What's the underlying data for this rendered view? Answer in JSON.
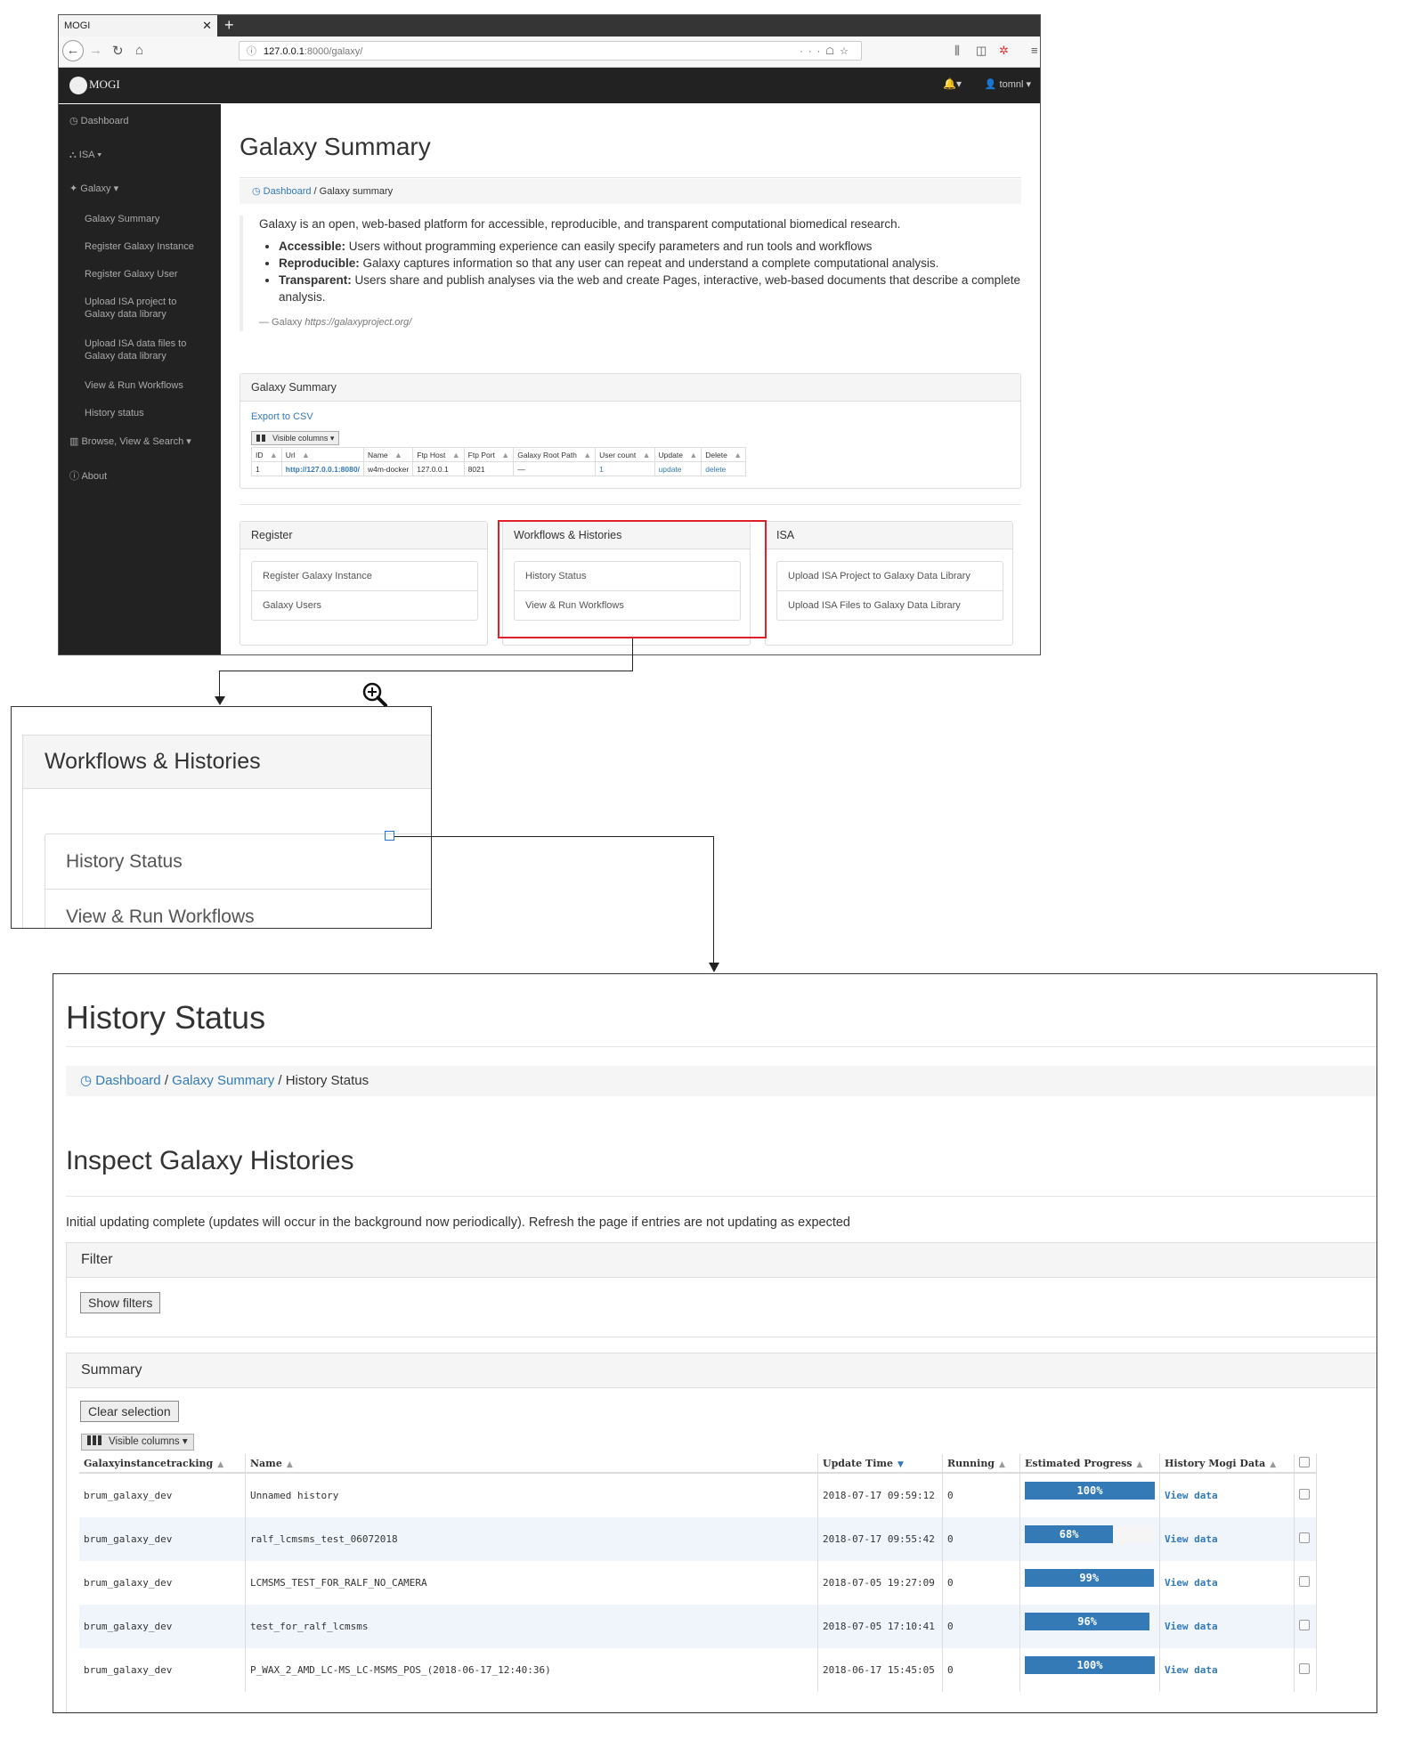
{
  "browser": {
    "tab_title": "MOGI",
    "url_host": "127.0.0.1",
    "url_path": ":8000/galaxy/",
    "app_brand": "MOGI",
    "user": "tomnl"
  },
  "sidebar": {
    "items": [
      {
        "label": "Dashboard"
      },
      {
        "label": "ISA"
      },
      {
        "label": "Galaxy"
      },
      {
        "label": "Galaxy Summary"
      },
      {
        "label": "Register Galaxy Instance"
      },
      {
        "label": "Register Galaxy User"
      },
      {
        "label": "Upload ISA project to Galaxy data library"
      },
      {
        "label": "Upload ISA data files to Galaxy data library"
      },
      {
        "label": "View & Run Workflows"
      },
      {
        "label": "History status"
      },
      {
        "label": "Browse, View & Search"
      },
      {
        "label": "About"
      }
    ]
  },
  "galaxy_page": {
    "title": "Galaxy Summary",
    "breadcrumb": {
      "home": "Dashboard",
      "current": "Galaxy summary"
    },
    "intro": "Galaxy is an open, web-based platform for accessible, reproducible, and transparent computational biomedical research.",
    "bullets": [
      {
        "term": "Accessible:",
        "text": " Users without programming experience can easily specify parameters and run tools and workflows"
      },
      {
        "term": "Reproducible:",
        "text": " Galaxy captures information so that any user can repeat and understand a complete computational analysis."
      },
      {
        "term": "Transparent:",
        "text": " Users share and publish analyses via the web and create Pages, interactive, web-based documents that describe a complete analysis."
      }
    ],
    "quote_source": "— Galaxy",
    "quote_url": "https://galaxyproject.org/",
    "summary_panel": {
      "title": "Galaxy Summary",
      "export": "Export to CSV",
      "visible_columns": "Visible columns",
      "columns": [
        "ID",
        "Url",
        "Name",
        "Ftp Host",
        "Ftp Port",
        "Galaxy Root Path",
        "User count",
        "Update",
        "Delete"
      ],
      "row": [
        "1",
        "http://127.0.0.1:8080/",
        "w4m-docker",
        "127.0.0.1",
        "8021",
        "—",
        "1",
        "update",
        "delete"
      ]
    },
    "register_panel": {
      "title": "Register",
      "items": [
        "Register Galaxy Instance",
        "Galaxy Users"
      ]
    },
    "workflows_panel": {
      "title": "Workflows & Histories",
      "items": [
        "History Status",
        "View & Run Workflows"
      ]
    },
    "isa_panel": {
      "title": "ISA",
      "items": [
        "Upload ISA Project to Galaxy Data Library",
        "Upload ISA Files to Galaxy Data Library"
      ]
    }
  },
  "zoom": {
    "title": "Workflows & Histories",
    "items": [
      "History Status",
      "View & Run Workflows"
    ]
  },
  "history_page": {
    "title": "History Status",
    "breadcrumb": {
      "home": "Dashboard",
      "mid": "Galaxy Summary",
      "current": "History Status"
    },
    "subtitle": "Inspect Galaxy Histories",
    "note": "Initial updating complete (updates will occur in the background now periodically). Refresh the page if entries are not updating as expected",
    "filter": {
      "title": "Filter",
      "button": "Show filters"
    },
    "summary": {
      "title": "Summary",
      "clear": "Clear selection",
      "visible_columns": "Visible columns",
      "columns": [
        "Galaxyinstancetracking",
        "Name",
        "Update Time",
        "Running",
        "Estimated Progress",
        "History Mogi Data"
      ],
      "rows": [
        {
          "instance": "brum_galaxy_dev",
          "name": "Unnamed history",
          "time": "2018-07-17 09:59:12",
          "running": "0",
          "progress": 100,
          "progress_label": "100%",
          "link": "View data"
        },
        {
          "instance": "brum_galaxy_dev",
          "name": "ralf_lcmsms_test_06072018",
          "time": "2018-07-17 09:55:42",
          "running": "0",
          "progress": 68,
          "progress_label": "68%",
          "link": "View data"
        },
        {
          "instance": "brum_galaxy_dev",
          "name": "LCMSMS_TEST_FOR_RALF_NO_CAMERA",
          "time": "2018-07-05 19:27:09",
          "running": "0",
          "progress": 99,
          "progress_label": "99%",
          "link": "View data"
        },
        {
          "instance": "brum_galaxy_dev",
          "name": "test_for_ralf_lcmsms",
          "time": "2018-07-05 17:10:41",
          "running": "0",
          "progress": 96,
          "progress_label": "96%",
          "link": "View data"
        },
        {
          "instance": "brum_galaxy_dev",
          "name": "P_WAX_2_AMD_LC-MS_LC-MSMS_POS_(2018-06-17_12:40:36)",
          "time": "2018-06-17 15:45:05",
          "running": "0",
          "progress": 100,
          "progress_label": "100%",
          "link": "View data"
        }
      ]
    }
  },
  "colors": {
    "accent": "#337ab7",
    "highlight": "#e0202a",
    "nav_dark": "#222222"
  }
}
